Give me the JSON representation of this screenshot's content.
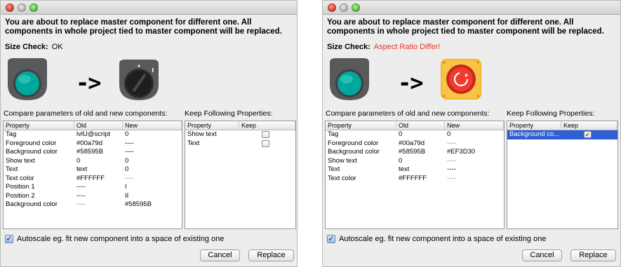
{
  "message": "You are about to replace master component for different one. All components in whole project tied to master component will be replaced.",
  "labels": {
    "size_check": "Size Check:",
    "compare": "Compare parameters of old and new components:",
    "keep": "Keep Following Properties:",
    "autoscale": "Autoscale eg. fit new component into a space of existing one",
    "cancel": "Cancel",
    "replace": "Replace",
    "arrow": "->"
  },
  "headers": {
    "params": [
      "Property",
      "Old",
      "New"
    ],
    "keep": [
      "Property",
      "Keep"
    ]
  },
  "colors": {
    "old_component_bg": "#58595B",
    "old_component_button": "#00a79d",
    "new_component_bg": "#EF3D30",
    "warning_text": "#e8352b",
    "selection": "#2f5fd0"
  },
  "left": {
    "size_check_value": "OK",
    "new_component_icon": "rotary-switch-icon",
    "params": [
      [
        "Tag",
        "lvlU@script",
        "0"
      ],
      [
        "Foreground color",
        "#00a79d",
        "----"
      ],
      [
        "Background color",
        "#58595B",
        "----"
      ],
      [
        "Show text",
        "0",
        "0"
      ],
      [
        "Text",
        "text",
        "0"
      ],
      [
        "Text color",
        "#FFFFFF",
        "----"
      ],
      [
        "Position 1",
        "----",
        "I"
      ],
      [
        "Position 2",
        "----",
        "II"
      ],
      [
        "Background color",
        "----",
        "#58595B"
      ]
    ],
    "keep": [
      {
        "property": "Show text",
        "checked": false
      },
      {
        "property": "Text",
        "checked": false
      }
    ],
    "autoscale_checked": true
  },
  "right": {
    "size_check_value": "Aspect Ratio Differ!",
    "new_component_icon": "emergency-stop-icon",
    "params": [
      [
        "Tag",
        "0",
        "0"
      ],
      [
        "Foreground color",
        "#00a79d",
        "----"
      ],
      [
        "Background color",
        "#58595B",
        "#EF3D30"
      ],
      [
        "Show text",
        "0",
        "----"
      ],
      [
        "Text",
        "text",
        "----"
      ],
      [
        "Text color",
        "#FFFFFF",
        "----"
      ]
    ],
    "keep": [
      {
        "property": "Background co...",
        "checked": true,
        "selected": true
      }
    ],
    "autoscale_checked": true
  }
}
